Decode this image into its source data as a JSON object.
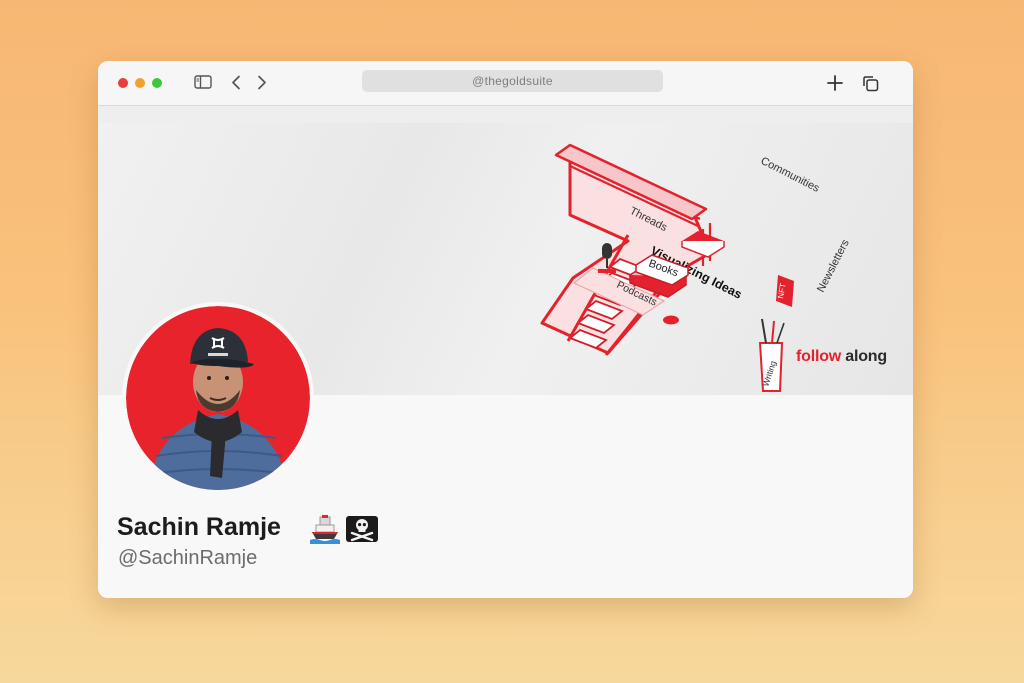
{
  "browser": {
    "address_text": "@thegoldsuite",
    "icons": [
      "sidebar-toggle-icon",
      "chevron-left-icon",
      "chevron-right-icon",
      "plus-icon",
      "tabs-overview-icon"
    ]
  },
  "banner": {
    "art_labels": {
      "main": "Visualizing Ideas",
      "communities": "Communities",
      "threads": "Threads",
      "newsletters": "Newsletters",
      "books": "Books",
      "podcasts": "Podcasts",
      "writing": "Writing",
      "nft": "NFT"
    },
    "tagline_part1": "follow",
    "tagline_part2": "along"
  },
  "profile": {
    "display_name": "Sachin Ramje",
    "handle": "@SachinRamje",
    "badges": [
      "ship-emoji",
      "pirate-flag-emoji"
    ]
  },
  "colors": {
    "background": "#f8c07a",
    "accent_red": "#e2232d",
    "avatar_bg": "#e8232b"
  }
}
